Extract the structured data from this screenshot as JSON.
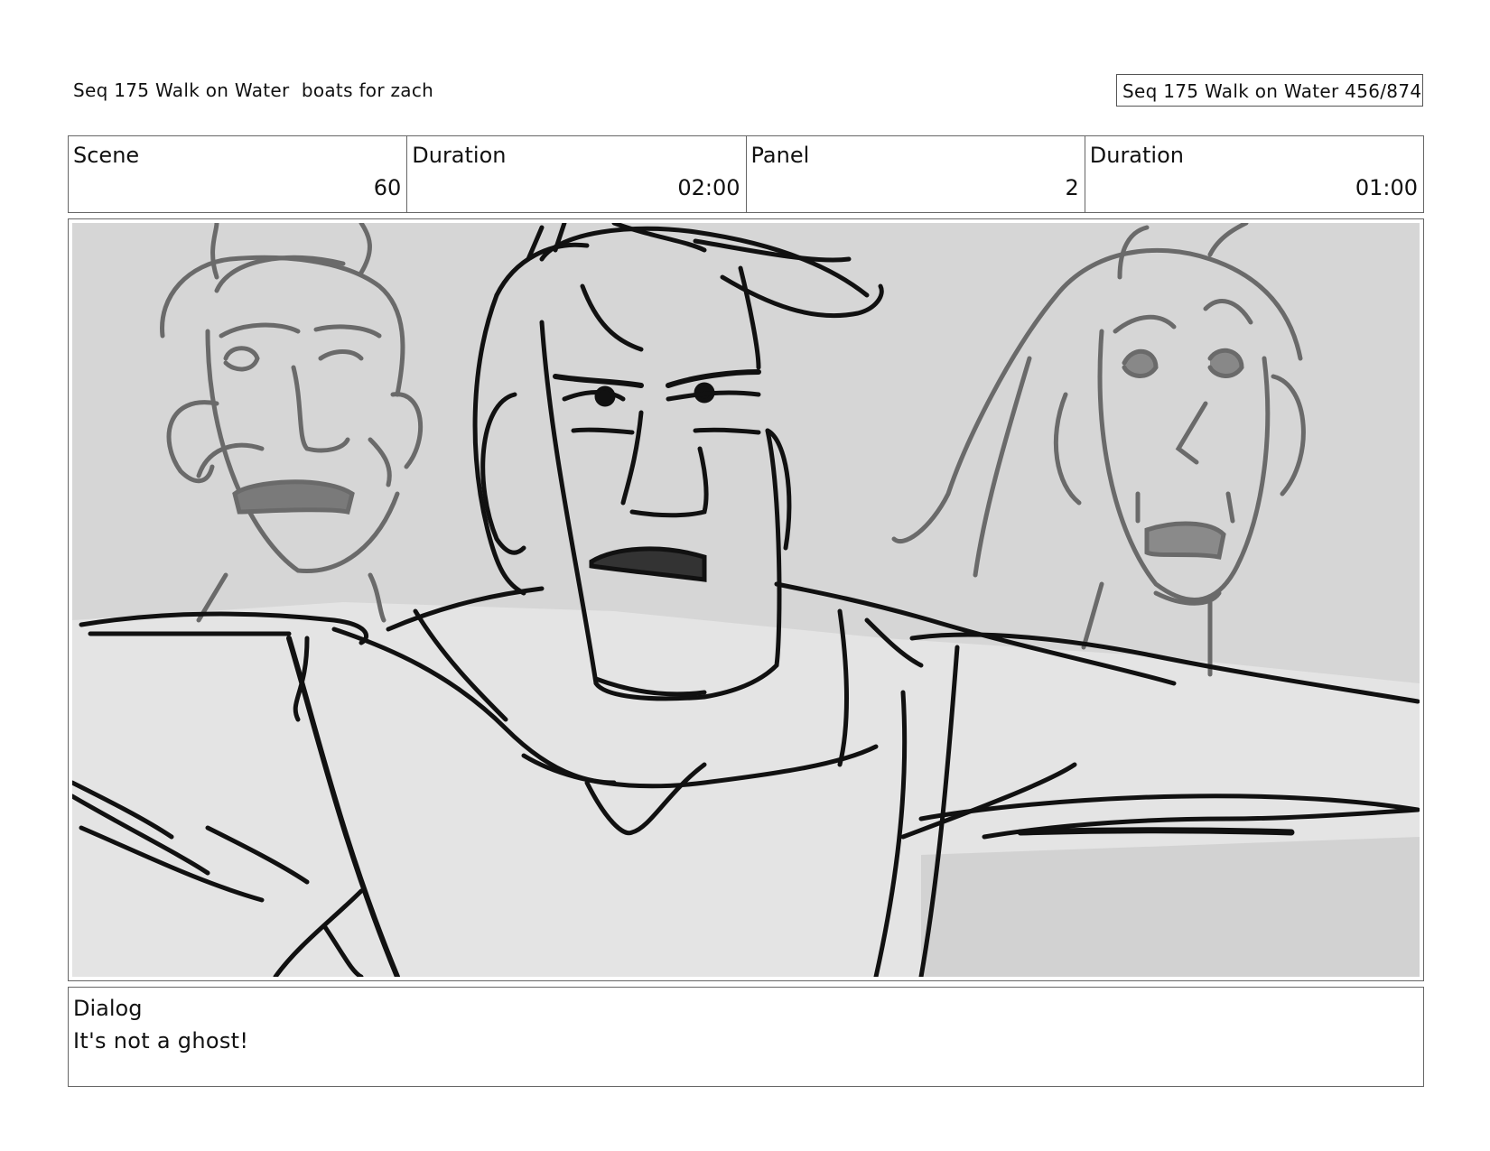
{
  "header": {
    "title": "Seq 175 Walk on Water  boats for zach",
    "page_counter": "Seq 175 Walk on Water 456/874"
  },
  "info": {
    "scene_label": "Scene",
    "scene_value": "60",
    "scene_duration_label": "Duration",
    "scene_duration_value": "02:00",
    "panel_label": "Panel",
    "panel_value": "2",
    "panel_duration_label": "Duration",
    "panel_duration_value": "01:00"
  },
  "panel": {
    "image_icon": "storyboard-sketch"
  },
  "dialog": {
    "label": "Dialog",
    "text": "It's not a ghost!"
  }
}
